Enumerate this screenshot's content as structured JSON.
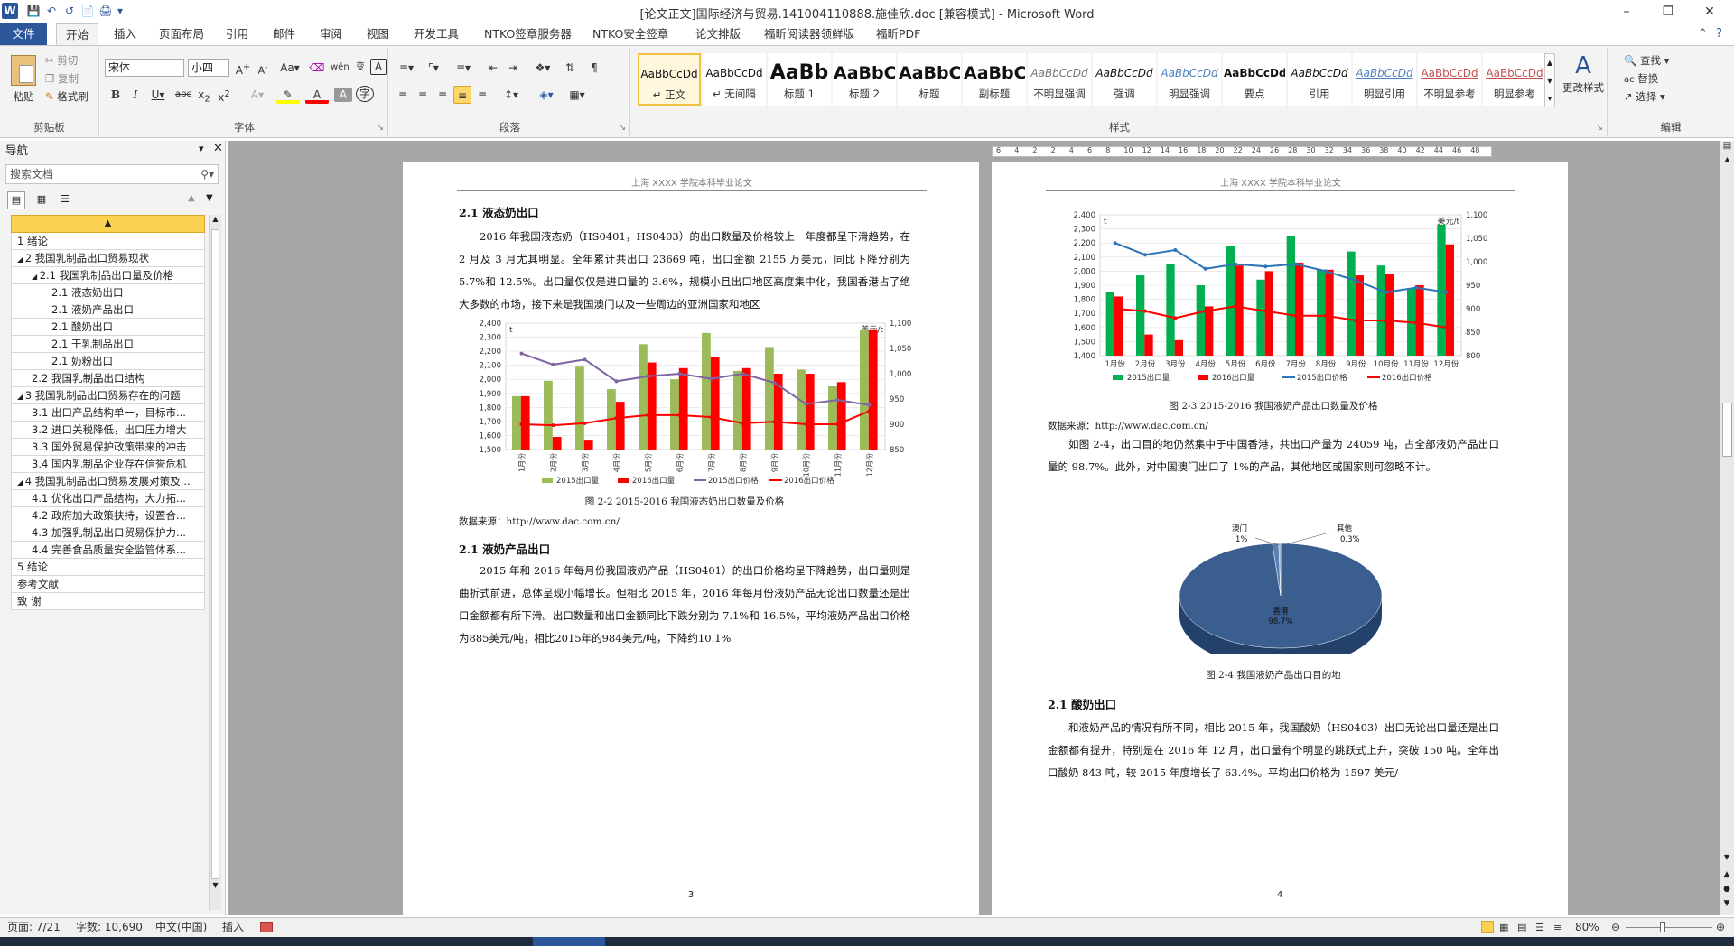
{
  "window": {
    "title": "[论文正文]国际经济与贸易.141004110888.施佳欣.doc [兼容模式] - Microsoft Word"
  },
  "tabs": [
    "文件",
    "开始",
    "插入",
    "页面布局",
    "引用",
    "邮件",
    "审阅",
    "视图",
    "开发工具",
    "NTKO签章服务器",
    "NTKO安全签章",
    "论文排版",
    "福昕阅读器领鲜版",
    "福昕PDF"
  ],
  "ribbon": {
    "clipboard": {
      "paste": "粘贴",
      "cut": "剪切",
      "copy": "复制",
      "format_painter": "格式刷",
      "label": "剪贴板"
    },
    "font": {
      "name": "宋体",
      "size": "小四",
      "label": "字体"
    },
    "paragraph": {
      "label": "段落"
    },
    "styles": {
      "label": "样式",
      "items": [
        {
          "preview": "AaBbCcDd",
          "name": "↵ 正文"
        },
        {
          "preview": "AaBbCcDd",
          "name": "↵ 无间隔"
        },
        {
          "preview": "AaBb",
          "name": "标题 1"
        },
        {
          "preview": "AaBbC",
          "name": "标题 2"
        },
        {
          "preview": "AaBbC",
          "name": "标题"
        },
        {
          "preview": "AaBbC",
          "name": "副标题"
        },
        {
          "preview": "AaBbCcDd",
          "name": "不明显强调"
        },
        {
          "preview": "AaBbCcDd",
          "name": "强调"
        },
        {
          "preview": "AaBbCcDd",
          "name": "明显强调"
        },
        {
          "preview": "AaBbCcDd",
          "name": "要点"
        },
        {
          "preview": "AaBbCcDd",
          "name": "引用"
        },
        {
          "preview": "AaBbCcDd",
          "name": "明显引用"
        },
        {
          "preview": "AaBbCcDd",
          "name": "不明显参考"
        },
        {
          "preview": "AaBbCcDd",
          "name": "明显参考"
        }
      ],
      "change": "更改样式"
    },
    "editing": {
      "find": "查找",
      "replace": "替换",
      "select": "选择",
      "label": "编辑"
    }
  },
  "nav": {
    "title": "导航",
    "search_placeholder": "搜索文档",
    "items": [
      {
        "label": "1 绪论",
        "level": 0
      },
      {
        "label": "2 我国乳制品出口贸易现状",
        "level": 0
      },
      {
        "label": "2.1 我国乳制品出口量及价格",
        "level": 1
      },
      {
        "label": "2.1 液态奶出口",
        "level": 2
      },
      {
        "label": "2.1 液奶产品出口",
        "level": 2
      },
      {
        "label": "2.1 酸奶出口",
        "level": 2
      },
      {
        "label": "2.1 干乳制品出口",
        "level": 2
      },
      {
        "label": "2.1 奶粉出口",
        "level": 2
      },
      {
        "label": "2.2 我国乳制品出口结构",
        "level": 1
      },
      {
        "label": "3 我国乳制品出口贸易存在的问题",
        "level": 0
      },
      {
        "label": "3.1 出口产品结构单一，目标市...",
        "level": 1
      },
      {
        "label": "3.2 进口关税降低，出口压力增大",
        "level": 1
      },
      {
        "label": "3.3 国外贸易保护政策带来的冲击",
        "level": 1
      },
      {
        "label": "3.4 国内乳制品企业存在信誉危机",
        "level": 1
      },
      {
        "label": "4 我国乳制品出口贸易发展对策及...",
        "level": 0
      },
      {
        "label": "4.1 优化出口产品结构，大力拓...",
        "level": 1
      },
      {
        "label": "4.2 政府加大政策扶持，设置合...",
        "level": 1
      },
      {
        "label": "4.3 加强乳制品出口贸易保护力...",
        "level": 1
      },
      {
        "label": "4.4 完善食品质量安全监管体系...",
        "level": 1
      },
      {
        "label": "5 结论",
        "level": 0
      },
      {
        "label": "参考文献",
        "level": 0
      },
      {
        "label": "致  谢",
        "level": 0
      }
    ]
  },
  "ruler": [
    "6",
    "4",
    "2",
    "2",
    "4",
    "6",
    "8",
    "10",
    "12",
    "14",
    "16",
    "18",
    "20",
    "22",
    "24",
    "26",
    "28",
    "30",
    "32",
    "34",
    "36",
    "38",
    "40",
    "42",
    "44",
    "46",
    "48"
  ],
  "page1": {
    "header": "上海 XXXX 学院本科毕业论文",
    "h1": "2.1   液态奶出口",
    "p1": "2016 年我国液态奶（HS0401，HS0403）的出口数量及价格较上一年度都呈下滑趋势，在 2 月及 3 月尤其明显。全年累计共出口 23669 吨，出口金额 2155 万美元，同比下降分别为 5.7%和 12.5%。出口量仅仅是进口量的 3.6%，规模小且出口地区高度集中化，我国香港占了绝大多数的市场，接下来是我国澳门以及一些周边的亚洲国家和地区",
    "caption": "图 2-2 2015-2016 我国液态奶出口数量及价格",
    "source": "数据来源：http://www.dac.com.cn/",
    "h2": "2.1   液奶产品出口",
    "p2": "2015 年和 2016 年每月份我国液奶产品（HS0401）的出口价格均呈下降趋势，出口量则是曲折式前进，总体呈现小幅增长。但相比 2015 年，2016 年每月份液奶产品无论出口数量还是出口金额都有所下滑。出口数量和出口金额同比下跌分别为 7.1%和 16.5%，平均液奶产品出口价格为885美元/吨，相比2015年的984美元/吨，下降约10.1%",
    "page_no": "3"
  },
  "page2": {
    "header": "上海 XXXX 学院本科毕业论文",
    "caption": "图 2-3 2015-2016 我国液奶产品出口数量及价格",
    "source": "数据来源：http://www.dac.com.cn/",
    "p1": "如图 2-4，出口目的地仍然集中于中国香港，共出口产量为 24059 吨，占全部液奶产品出口量的 98.7%。此外，对中国澳门出口了 1%的产品，其他地区或国家则可忽略不计。",
    "pie_caption": "图 2-4  我国液奶产品出口目的地",
    "h3": "2.1   酸奶出口",
    "p2": "和液奶产品的情况有所不同，相比 2015 年，我国酸奶（HS0403）出口无论出口量还是出口金额都有提升，特别是在 2016 年 12 月，出口量有个明显的跳跃式上升，突破 150 吨。全年出口酸奶 843 吨，较 2015 年度增长了 63.4%。平均出口价格为 1597 美元/",
    "page_no": "4"
  },
  "chart_data": [
    {
      "type": "bar",
      "title": "",
      "categories": [
        "1月份",
        "2月份",
        "3月份",
        "4月份",
        "5月份",
        "6月份",
        "7月份",
        "8月份",
        "9月份",
        "10月份",
        "11月份",
        "12月份"
      ],
      "ylim": [
        1500,
        2400
      ],
      "y_ticks": [
        "1,500",
        "1,600",
        "1,700",
        "1,800",
        "1,900",
        "2,000",
        "2,100",
        "2,200",
        "2,300",
        "2,400"
      ],
      "y2lim": [
        850,
        1100
      ],
      "y2_ticks": [
        "850",
        "900",
        "950",
        "1,000",
        "1,050",
        "1,100"
      ],
      "ylabel": "t",
      "y2label": "美元/t",
      "legend": "bottom",
      "series": [
        {
          "name": "2015出口量",
          "kind": "bar",
          "color": "#9bbb59",
          "values": [
            1880,
            1990,
            2090,
            1930,
            2250,
            2000,
            2330,
            2060,
            2230,
            2070,
            1950,
            2350
          ]
        },
        {
          "name": "2016出口量",
          "kind": "bar",
          "color": "#ff0000",
          "values": [
            1880,
            1590,
            1570,
            1840,
            2120,
            2080,
            2160,
            2080,
            2040,
            2040,
            1980,
            2350
          ]
        },
        {
          "name": "2015出口价格",
          "kind": "line",
          "axis": "y2",
          "color": "#8064a2",
          "values": [
            1040,
            1018,
            1028,
            985,
            995,
            1000,
            990,
            1000,
            982,
            940,
            948,
            938
          ]
        },
        {
          "name": "2016出口价格",
          "kind": "line",
          "axis": "y2",
          "color": "#ff0000",
          "values": [
            900,
            898,
            902,
            912,
            918,
            918,
            914,
            902,
            905,
            900,
            900,
            926
          ]
        }
      ]
    },
    {
      "type": "bar",
      "title": "",
      "categories": [
        "1月份",
        "2月份",
        "3月份",
        "4月份",
        "5月份",
        "6月份",
        "7月份",
        "8月份",
        "9月份",
        "10月份",
        "11月份",
        "12月份"
      ],
      "ylim": [
        1400,
        2400
      ],
      "y_ticks": [
        "1,400",
        "1,500",
        "1,600",
        "1,700",
        "1,800",
        "1,900",
        "2,000",
        "2,100",
        "2,200",
        "2,300",
        "2,400"
      ],
      "y2lim": [
        800,
        1100
      ],
      "y2_ticks": [
        "800",
        "850",
        "900",
        "950",
        "1,000",
        "1,050",
        "1,100"
      ],
      "ylabel": "t",
      "y2label": "美元/t",
      "legend": "bottom",
      "series": [
        {
          "name": "2015出口量",
          "kind": "bar",
          "color": "#00b050",
          "values": [
            1850,
            1970,
            2050,
            1900,
            2180,
            1940,
            2250,
            2010,
            2140,
            2040,
            1880,
            2330
          ]
        },
        {
          "name": "2016出口量",
          "kind": "bar",
          "color": "#ff0000",
          "values": [
            1820,
            1550,
            1510,
            1750,
            2040,
            2000,
            2060,
            2010,
            1970,
            1980,
            1900,
            2190
          ]
        },
        {
          "name": "2015出口价格",
          "kind": "line",
          "axis": "y2",
          "color": "#2e75b6",
          "values": [
            1040,
            1015,
            1025,
            985,
            995,
            990,
            995,
            980,
            960,
            935,
            945,
            935
          ]
        },
        {
          "name": "2016出口价格",
          "kind": "line",
          "axis": "y2",
          "color": "#ff0000",
          "values": [
            900,
            895,
            880,
            895,
            905,
            895,
            885,
            885,
            875,
            875,
            870,
            860
          ]
        }
      ]
    },
    {
      "type": "pie",
      "title": "",
      "slices": [
        {
          "label": "香港",
          "value": 98.7,
          "display": "98.7%",
          "color": "#3a5f8f"
        },
        {
          "label": "澳门",
          "value": 1,
          "display": "1%",
          "color": "#5b7fb0"
        },
        {
          "label": "其他",
          "value": 0.3,
          "display": "0.3%",
          "color": "#8aa6cc"
        }
      ]
    }
  ],
  "statusbar": {
    "page": "页面: 7/21",
    "words": "字数: 10,690",
    "lang": "中文(中国)",
    "mode": "插入",
    "zoom": "80%"
  }
}
